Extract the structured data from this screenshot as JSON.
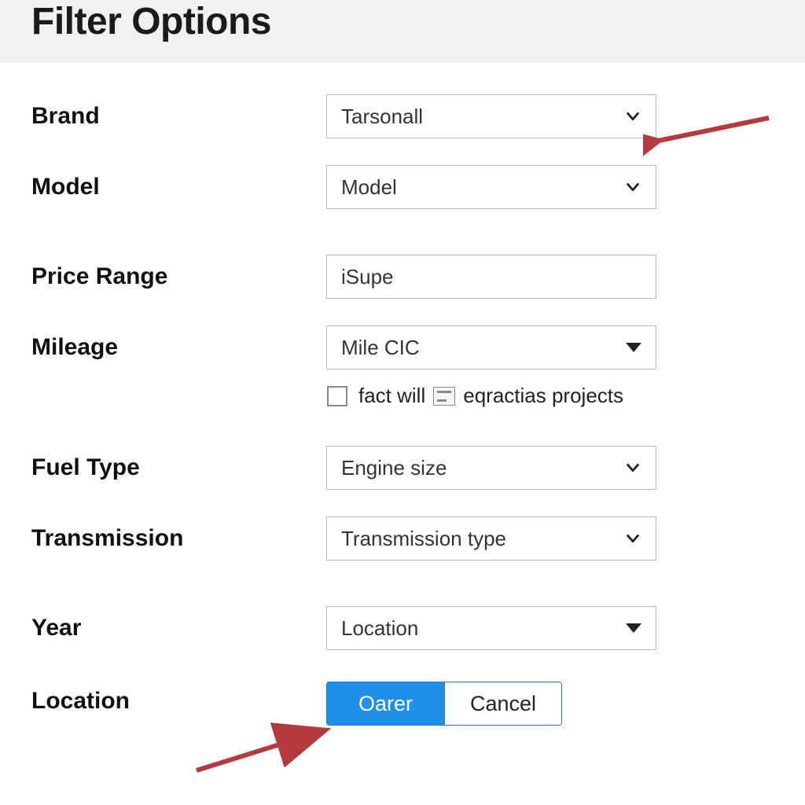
{
  "header": {
    "title": "Filter Options"
  },
  "labels": {
    "brand": "Brand",
    "model": "Model",
    "price_range": "Price Range",
    "mileage": "Mileage",
    "fuel_type": "Fuel Type",
    "transmission": "Transmission",
    "year": "Year",
    "location": "Location"
  },
  "fields": {
    "brand": {
      "value": "Tarsonall"
    },
    "model": {
      "value": "Model"
    },
    "price_range": {
      "value": "iSupe"
    },
    "mileage": {
      "value": "Mile CIC"
    },
    "fuel_type": {
      "value": "Engine size"
    },
    "transmission": {
      "value": "Transmission type"
    },
    "year": {
      "value": "Location"
    }
  },
  "checkbox": {
    "text_left": "fact will",
    "text_right": "eqractias projects"
  },
  "buttons": {
    "primary": "Oarer",
    "secondary": "Cancel"
  },
  "colors": {
    "header_bg": "#eef0f2",
    "accent": "#1f8fe8",
    "arrow": "#b53a3f"
  }
}
